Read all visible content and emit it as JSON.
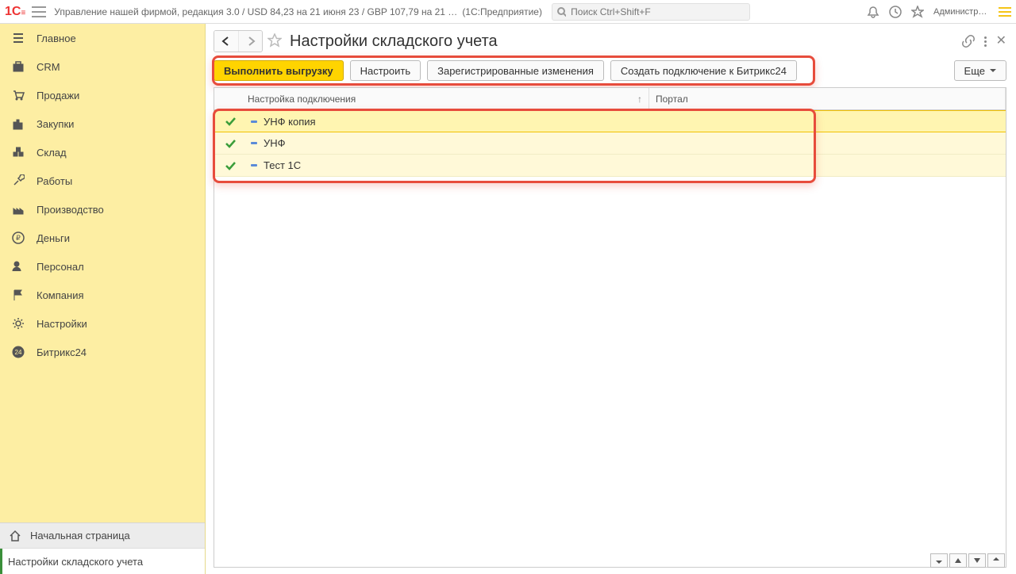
{
  "header": {
    "app_title": "Управление нашей фирмой, редакция 3.0 / USD 84,23 на 21 июня 23 / GBP 107,79 на 21 …",
    "mode": "(1С:Предприятие)",
    "search_placeholder": "Поиск Ctrl+Shift+F",
    "user": "Администрат..."
  },
  "sidebar": {
    "items": [
      {
        "label": "Главное"
      },
      {
        "label": "CRM"
      },
      {
        "label": "Продажи"
      },
      {
        "label": "Закупки"
      },
      {
        "label": "Склад"
      },
      {
        "label": "Работы"
      },
      {
        "label": "Производство"
      },
      {
        "label": "Деньги"
      },
      {
        "label": "Персонал"
      },
      {
        "label": "Компания"
      },
      {
        "label": "Настройки"
      },
      {
        "label": "Битрикс24"
      }
    ],
    "bottom": [
      {
        "label": "Начальная страница"
      },
      {
        "label": "Настройки складского учета"
      }
    ]
  },
  "page": {
    "title": "Настройки складского учета",
    "toolbar": {
      "run": "Выполнить выгрузку",
      "configure": "Настроить",
      "changes": "Зарегистрированные изменения",
      "create": "Создать подключение к Битрикс24",
      "more": "Еще"
    },
    "grid": {
      "col1": "Настройка подключения",
      "col2": "Портал",
      "rows": [
        {
          "name": "УНФ копия"
        },
        {
          "name": "УНФ"
        },
        {
          "name": "Тест 1С"
        }
      ]
    }
  }
}
